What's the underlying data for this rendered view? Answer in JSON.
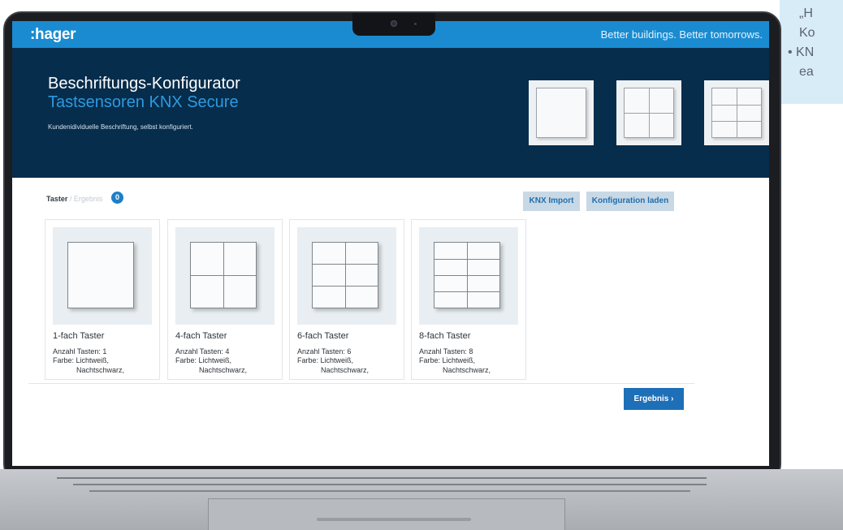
{
  "callout": {
    "line1": "„H",
    "line2": "Ko",
    "line3": "• KN",
    "line4": "ea"
  },
  "app": {
    "logo": ":hager",
    "tagline": "Better buildings. Better tomorrows."
  },
  "hero": {
    "title": "Beschriftungs-Konfigurator",
    "subtitle": "Tastsensoren KNX Secure",
    "description": "Kundenidividuelle Beschriftung, selbst konfiguriert."
  },
  "breadcrumb": {
    "active": "Taster",
    "separator": "/",
    "next": "Ergebnis",
    "badge_count": "0"
  },
  "toolbar": {
    "knx_import": "KNX Import",
    "load_config": "Konfiguration laden"
  },
  "products": [
    {
      "title": "1-fach Taster",
      "keys": "Anzahl Tasten: 1",
      "color_label": "Farbe: Lichtweiß,",
      "color_more": "Nachtschwarz,"
    },
    {
      "title": "4-fach Taster",
      "keys": "Anzahl Tasten: 4",
      "color_label": "Farbe: Lichtweiß,",
      "color_more": "Nachtschwarz,"
    },
    {
      "title": "6-fach Taster",
      "keys": "Anzahl Tasten: 6",
      "color_label": "Farbe: Lichtweiß,",
      "color_more": "Nachtschwarz,"
    },
    {
      "title": "8-fach Taster",
      "keys": "Anzahl Tasten: 8",
      "color_label": "Farbe: Lichtweiß,",
      "color_more": "Nachtschwarz,"
    }
  ],
  "actions": {
    "result_label": "Ergebnis",
    "result_arrow": "›"
  },
  "colors": {
    "topbar": "#1a8bd1",
    "hero": "#072d4c",
    "accent": "#1d6fb8",
    "callout": "#d8ecf8"
  }
}
